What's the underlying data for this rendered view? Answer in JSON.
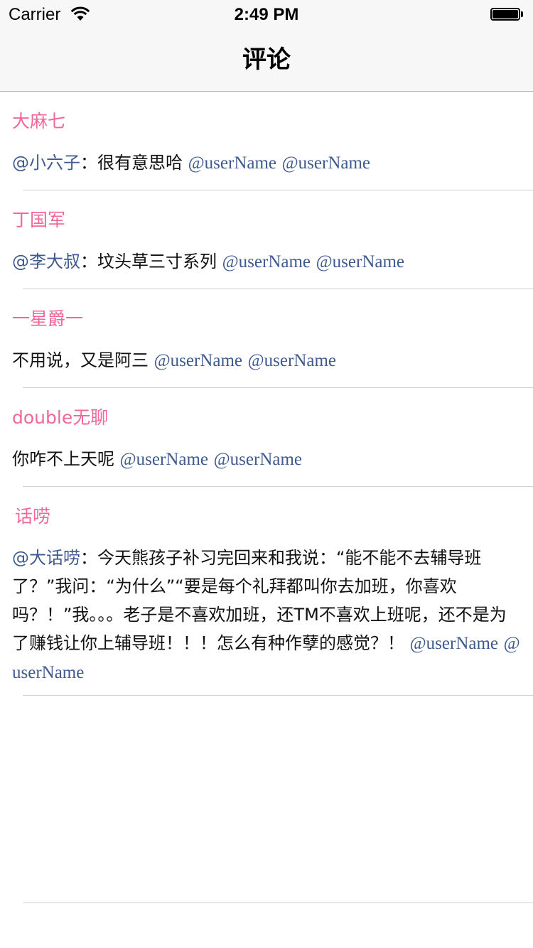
{
  "status_bar": {
    "carrier": "Carrier",
    "time": "2:49 PM",
    "wifi_icon": "wifi-icon",
    "battery_icon": "battery-icon"
  },
  "nav": {
    "title": "评论"
  },
  "colors": {
    "username": "#f06799",
    "mention": "#3e5a8f",
    "text": "#111111",
    "separator": "#d0d0d4"
  },
  "comments": [
    {
      "user": "大麻七",
      "reply_to": "@小六子",
      "colon": "：",
      "text": "很有意思哈",
      "mention1": "@userName",
      "mention2": "@userName"
    },
    {
      "user": "丁国军",
      "reply_to": "@李大叔",
      "colon": "：",
      "text": "坟头草三寸系列",
      "mention1": "@userName",
      "mention2": "@userName"
    },
    {
      "user": "一星爵一",
      "reply_to": "",
      "colon": "",
      "text": "不用说，又是阿三",
      "mention1": "@userName",
      "mention2": "@userName"
    },
    {
      "user": "double无聊",
      "reply_to": "",
      "colon": "",
      "text": "你咋不上天呢",
      "mention1": "@userName",
      "mention2": "@userName"
    },
    {
      "user": "话唠",
      "reply_to": "@大话唠",
      "colon": "：",
      "text": "今天熊孩子补习完回来和我说：“能不能不去辅导班了？”我问：“为什么”“要是每个礼拜都叫你去加班，你喜欢吗？！”我。。。老子是不喜欢加班，还TM不喜欢上班呢，还不是为了赚钱让你上辅导班！！！怎么有种作孽的感觉？！",
      "mention1": "@userName",
      "mention2": "@userName"
    }
  ]
}
